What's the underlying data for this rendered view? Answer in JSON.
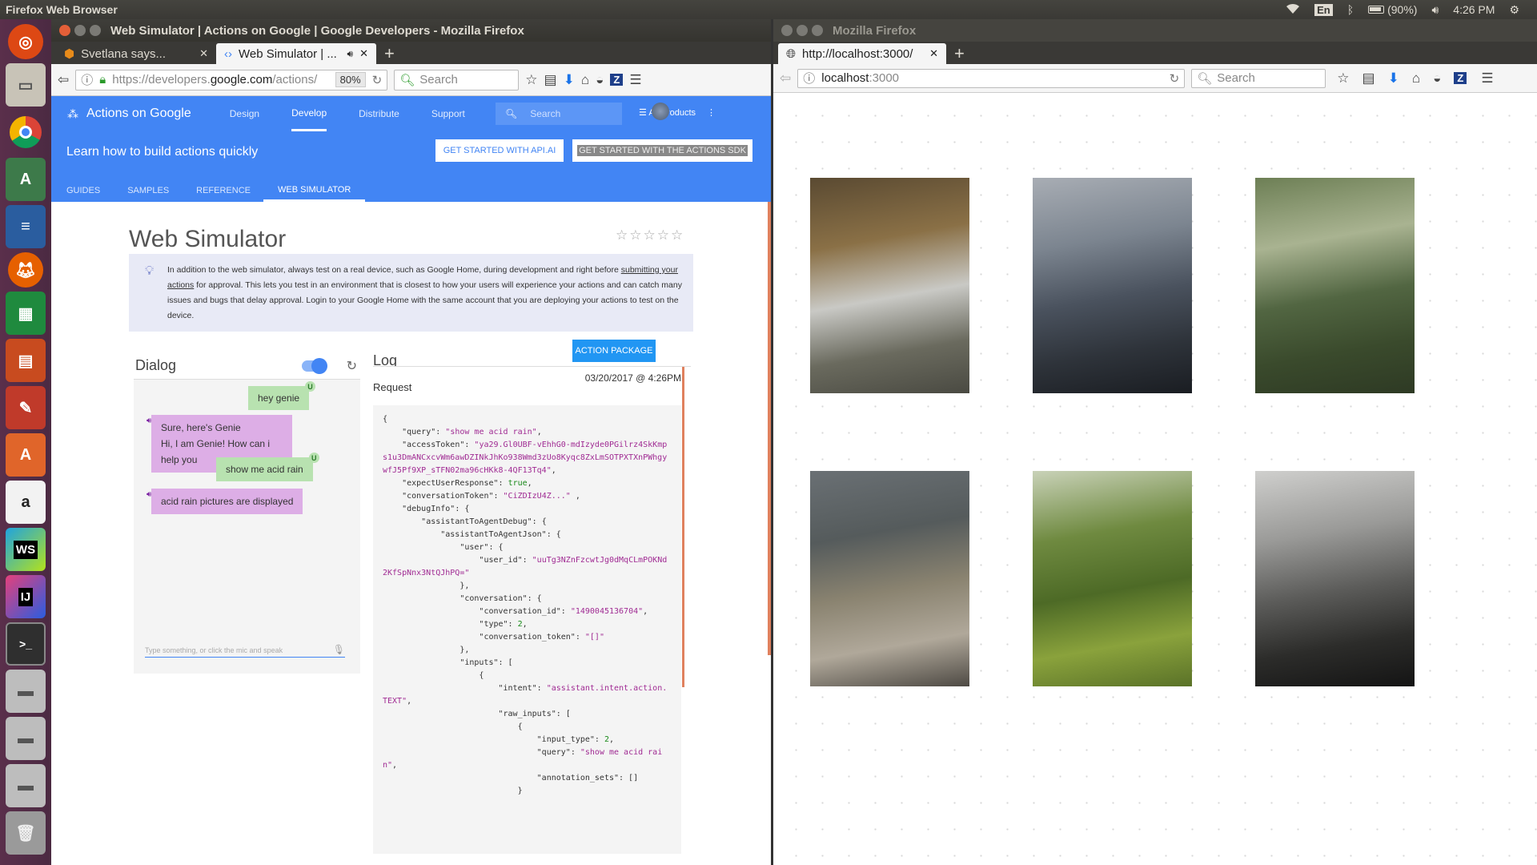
{
  "topbar": {
    "title": "Firefox Web Browser",
    "lang": "En",
    "battery": "(90%)",
    "time": "4:26 PM"
  },
  "launcher": [
    "ubuntu-icon",
    "files-icon",
    "chrome-icon",
    "android-studio-icon",
    "writer-icon",
    "firefox-icon",
    "calc-icon",
    "impress-icon",
    "settings-icon",
    "software-center-icon",
    "amazon-icon",
    "webstorm-icon",
    "intellij-icon",
    "terminal-icon",
    "disk-icon",
    "disk-icon",
    "disk-icon",
    "trash-icon"
  ],
  "left": {
    "window_title": "Web Simulator  |  Actions on Google  |  Google Developers - Mozilla Firefox",
    "tabs": [
      {
        "label": "Svetlana says..."
      },
      {
        "label": "Web Simulator | ..."
      }
    ],
    "url_prefix": "https://developers.",
    "url_domain": "google.com",
    "url_suffix": "/actions/",
    "zoom": "80%",
    "search_placeholder": "Search",
    "brand": "Actions on Google",
    "nav": [
      "Design",
      "Develop",
      "Distribute",
      "Support"
    ],
    "gsearch": "Search",
    "all_products": "All Products",
    "subtitle": "Learn how to build actions quickly",
    "btn_apiai": "GET STARTED WITH API.AI",
    "btn_sdk": "GET STARTED WITH THE ACTIONS SDK",
    "subtabs": [
      "GUIDES",
      "SAMPLES",
      "REFERENCE",
      "WEB SIMULATOR"
    ],
    "page_title": "Web Simulator",
    "info_pre": "In addition to the web simulator, always test on a real device, such as Google Home, during development and right before ",
    "info_link": "submitting your actions",
    "info_post": " for approval. This lets you test in an environment that is closest to how your users will experience your actions and can catch many issues and bugs that delay approval. Login to your Google Home with the same account that you are deploying your actions to test on the device.",
    "dialog_title": "Dialog",
    "log_title": "Log",
    "action_package": "ACTION PACKAGE",
    "messages": {
      "u1": "hey genie",
      "a1l1": "Sure, here's Genie",
      "a1l2": "Hi, I am Genie! How can i help you",
      "u2": "show me acid rain",
      "a2": "acid rain pictures are displayed",
      "badge": "U"
    },
    "type_placeholder": "Type something, or click the mic and speak",
    "request_label": "Request",
    "request_date": "03/20/2017 @ 4:26PM",
    "code_lines": [
      "{",
      "    \"query\": \"show me acid rain\",",
      "    \"accessToken\": \"ya29.Gl0UBF-vEhhG0-mdIzyde0PGilrz4SkKmps1u3DmANCxcvWm6awDZINkJhKo938Wmd3zUo8Kyqc8ZxLmSOTPXTXnPWhgywfJ5Pf9XP_sTFN02ma96cHKk8-4QF13Tq4\",",
      "    \"expectUserResponse\": true,",
      "    \"conversationToken\": \"CiZDIzU4Z...\" ,",
      "    \"debugInfo\": {",
      "        \"assistantToAgentDebug\": {",
      "            \"assistantToAgentJson\": {",
      "                \"user\": {",
      "                    \"user_id\": \"uuTg3NZnFzcwtJg0dMqCLmPOKNd2KfSpNnx3NtQJhPQ=\"",
      "                },",
      "                \"conversation\": {",
      "                    \"conversation_id\": \"1490045136704\",",
      "                    \"type\": 2,",
      "                    \"conversation_token\": \"[]\"",
      "                },",
      "                \"inputs\": [",
      "                    {",
      "                        \"intent\": \"assistant.intent.action.TEXT\",",
      "                        \"raw_inputs\": [",
      "                            {",
      "                                \"input_type\": 2,",
      "                                \"query\": \"show me acid rain\",",
      "                                \"annotation_sets\": []",
      "                            }"
    ]
  },
  "right": {
    "window_title": "Mozilla Firefox",
    "tab": "http://localhost:3000/",
    "url_host": "localhost",
    "url_port": ":3000",
    "search_placeholder": "Search",
    "photos": [
      {
        "name": "photo-misty-river",
        "colors": [
          "#5a4a32",
          "#8a7046",
          "#c9c9c5",
          "#6a6a5e",
          "#4a4a42"
        ]
      },
      {
        "name": "photo-smog-city",
        "colors": [
          "#a8adb4",
          "#7c8590",
          "#4a525e",
          "#2e333a",
          "#1a1d22"
        ]
      },
      {
        "name": "photo-misty-forest",
        "colors": [
          "#6d7f55",
          "#a9b391",
          "#526642",
          "#3a4a2c",
          "#2e3a24"
        ]
      },
      {
        "name": "photo-flood-house",
        "colors": [
          "#6a7074",
          "#555b5c",
          "#8a8370",
          "#b0a89a",
          "#4e4a44"
        ]
      },
      {
        "name": "photo-algae-canal",
        "colors": [
          "#c9d2b8",
          "#6f8a40",
          "#4d6a26",
          "#8aa23c",
          "#5a7228"
        ]
      },
      {
        "name": "photo-foggy-rock",
        "colors": [
          "#cfcfcd",
          "#9a9a98",
          "#5c5c5a",
          "#2c2c2a",
          "#141414"
        ]
      }
    ]
  }
}
